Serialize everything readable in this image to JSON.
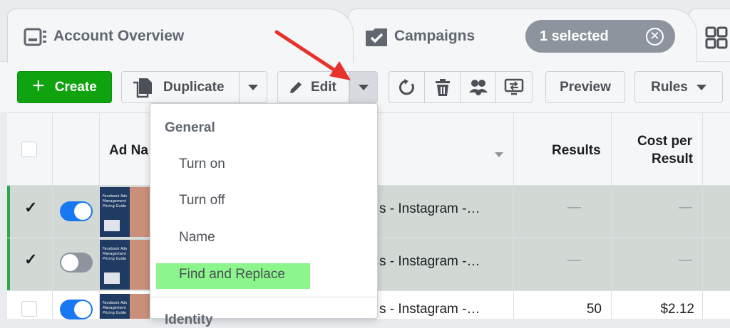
{
  "tabs": {
    "account_overview": "Account Overview",
    "campaigns": "Campaigns",
    "selected_pill": "1 selected"
  },
  "toolbar": {
    "create": "Create",
    "duplicate": "Duplicate",
    "edit": "Edit",
    "preview": "Preview",
    "rules": "Rules"
  },
  "table": {
    "headers": {
      "ad_name": "Ad Na",
      "results": "Results",
      "cost_per_result_line1": "Cost per",
      "cost_per_result_line2": "Result"
    },
    "rows": [
      {
        "checked": true,
        "on": true,
        "name": "s - Instagram -…",
        "results": "—",
        "cost": "—",
        "thumb_text": "Facebook Ads Management Pricing Guide"
      },
      {
        "checked": true,
        "on": false,
        "name": "s - Instagram -…",
        "results": "—",
        "cost": "—",
        "thumb_text": "Facebook Ads Management Pricing Guide"
      },
      {
        "checked": false,
        "on": true,
        "name": "s - Instagram -…",
        "results": "50",
        "cost": "$2.12",
        "thumb_text": "Facebook Ads Management Pricing Guide"
      }
    ]
  },
  "dropdown": {
    "heading_general": "General",
    "items": [
      "Turn on",
      "Turn off",
      "Name",
      "Find and Replace"
    ],
    "heading_identity": "Identity"
  },
  "colors": {
    "create_green": "#0fa30f",
    "toggle_blue": "#1877f2",
    "highlight_green": "#8cf58c",
    "arrow_red": "#e8322e"
  }
}
